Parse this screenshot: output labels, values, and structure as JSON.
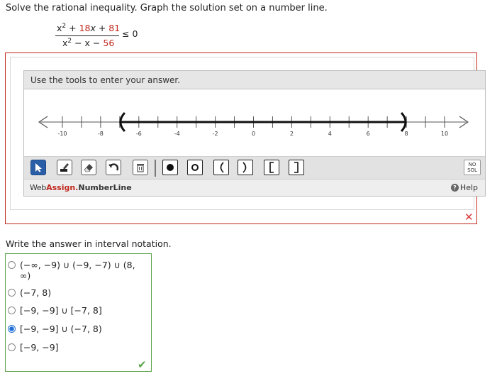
{
  "question": {
    "instruction": "Solve the rational inequality. Graph the solution set on a number line.",
    "numerator": {
      "x_term": "x",
      "exp": "2",
      "plus1": " + ",
      "b": "18",
      "x2": "x",
      "plus2": " + ",
      "c": "81"
    },
    "denominator": {
      "x_term": "x",
      "exp": "2",
      "rest": " − x − ",
      "c": "56"
    },
    "relation": "≤ 0"
  },
  "numberline_tool": {
    "prompt": "Use the tools to enter your answer.",
    "axis": {
      "min": -11,
      "max": 11,
      "tick_labels": [
        "-10",
        "-8",
        "-6",
        "-4",
        "-2",
        "0",
        "2",
        "4",
        "6",
        "8",
        "10"
      ]
    },
    "graph": {
      "left_endpoint": -7,
      "left_type": "open",
      "right_endpoint": 8,
      "right_type": "closed"
    },
    "tools": [
      "select-tool",
      "pencil-tool",
      "eraser-tool",
      "undo-tool",
      "trash-tool",
      "closed-point-tool",
      "open-point-tool",
      "left-paren-tool",
      "right-paren-tool",
      "left-bracket-tool",
      "right-bracket-tool"
    ],
    "nosol_label_1": "NO",
    "nosol_label_2": "SOL",
    "brand_web": "Web",
    "brand_assign": "Assign.",
    "brand_product": "NumberLine",
    "help_label": "Help",
    "status_icon": "x-mark-icon"
  },
  "interval_question": {
    "prompt": "Write the answer in interval notation.",
    "options": [
      {
        "label": "(−∞, −9) ∪ (−9, −7) ∪ (8, ∞)",
        "selected": false
      },
      {
        "label": "(−7, 8)",
        "selected": false
      },
      {
        "label": "[−9, −9] ∪ [−7, 8]",
        "selected": false
      },
      {
        "label": "[−9, −9] ∪ (−7, 8)",
        "selected": true
      },
      {
        "label": "[−9, −9]",
        "selected": false
      }
    ],
    "status_icon": "check-mark-icon"
  },
  "colors": {
    "accent_red": "#c0281e",
    "correct_green": "#5aa34a",
    "select_blue": "#2a5fa8"
  }
}
